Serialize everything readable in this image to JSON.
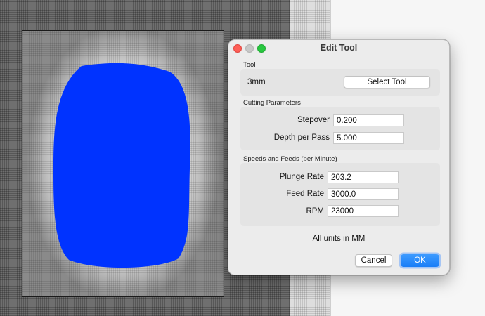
{
  "dialog": {
    "title": "Edit Tool",
    "tool_group": {
      "label": "Tool",
      "tool_name": "3mm",
      "select_button": "Select Tool"
    },
    "cutting_group": {
      "label": "Cutting Parameters",
      "stepover_label": "Stepover",
      "stepover_value": "0.200",
      "depth_label": "Depth per Pass",
      "depth_value": "5.000"
    },
    "speeds_group": {
      "label": "Speeds and Feeds (per Minute)",
      "plunge_label": "Plunge Rate",
      "plunge_value": "203.2",
      "feed_label": "Feed Rate",
      "feed_value": "3000.0",
      "rpm_label": "RPM",
      "rpm_value": "23000"
    },
    "units_note": "All units in MM",
    "cancel_button": "Cancel",
    "ok_button": "OK"
  },
  "colors": {
    "toolpath_fill": "#0033ff",
    "accent": "#1a7ef7"
  }
}
